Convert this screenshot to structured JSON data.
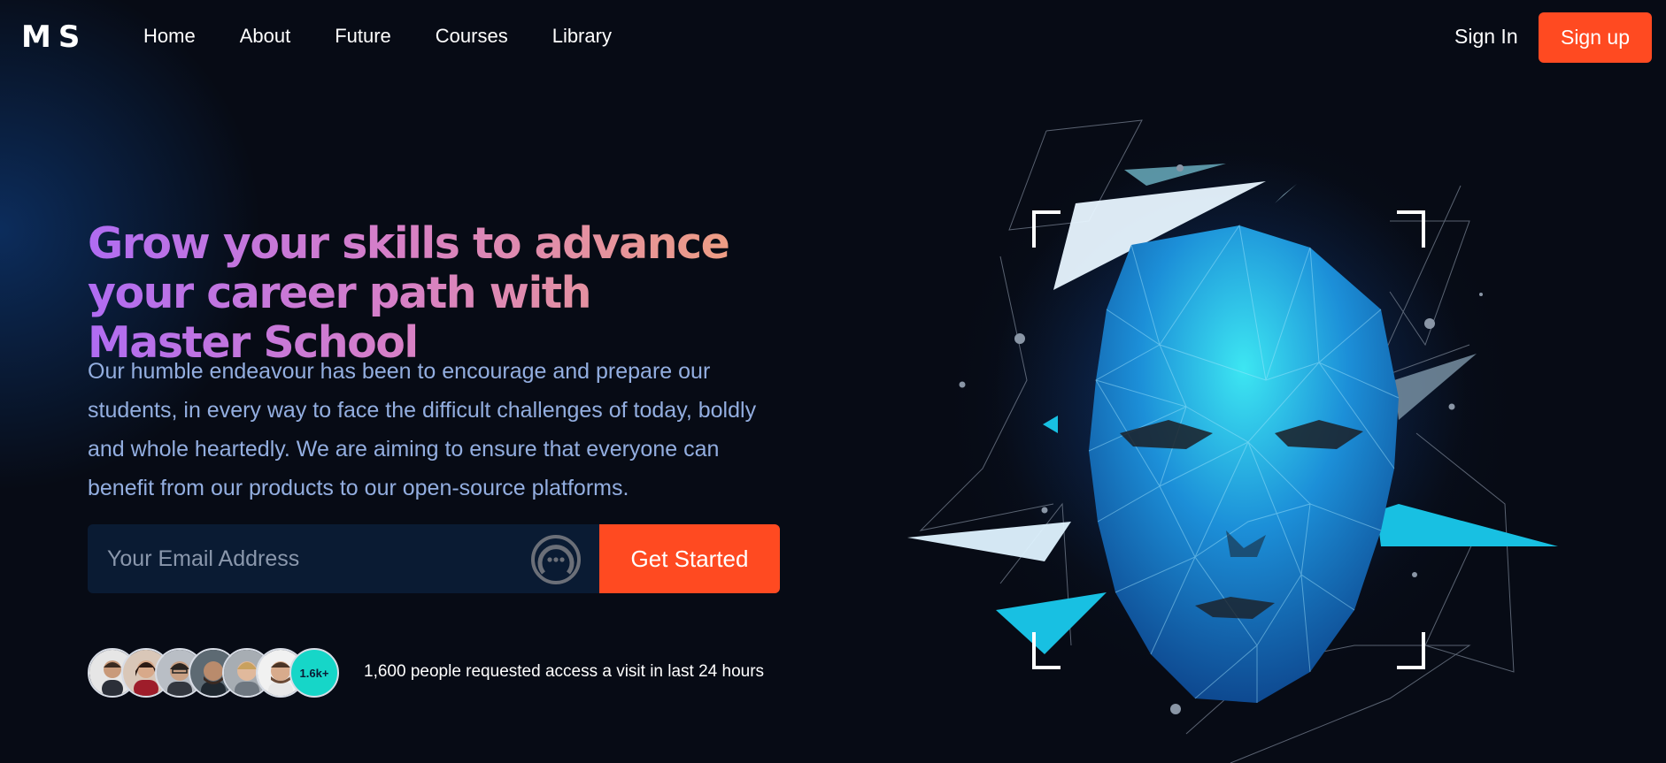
{
  "brand": {
    "logo": "MS"
  },
  "nav": {
    "links": [
      "Home",
      "About",
      "Future",
      "Courses",
      "Library"
    ],
    "sign_in": "Sign In",
    "sign_up": "Sign up"
  },
  "hero": {
    "headline": "Grow your skills to advance your career path with Master School",
    "description": "Our humble endeavour has been to encourage and prepare our students, in every way to face the difficult challenges of today, boldly and whole heartedly. We are aiming to ensure that everyone can benefit from our products to our open-source platforms.",
    "email_placeholder": "Your Email Address",
    "cta": "Get Started",
    "social_proof_badge": "1.6k+",
    "social_proof_text": "1,600 people requested access a visit in last 24 hours"
  },
  "colors": {
    "accent": "#ff4a21",
    "background": "#070b15",
    "badge": "#16d6c8",
    "headline_gradient": [
      "#b06cf2",
      "#f0a07e"
    ]
  },
  "icons": {
    "password_manager": "key-circle-icon",
    "hero_art": "polygon-face-illustration"
  }
}
